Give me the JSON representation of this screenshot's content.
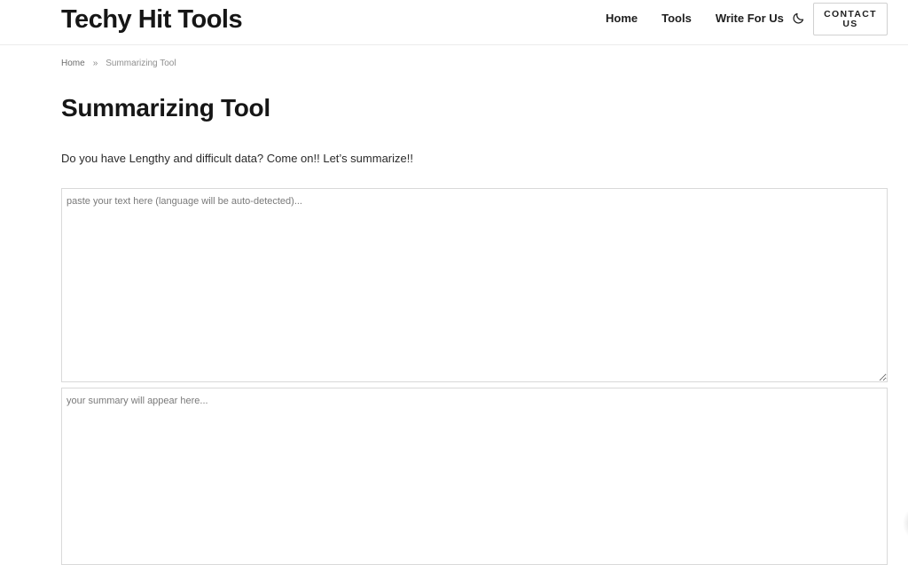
{
  "header": {
    "logo": "Techy Hit Tools",
    "nav": [
      {
        "label": "Home"
      },
      {
        "label": "Tools"
      },
      {
        "label": "Write For Us"
      }
    ],
    "theme_toggle_icon": "moon-icon",
    "contact_label": "CONTACT US"
  },
  "breadcrumb": {
    "home": "Home",
    "separator": "»",
    "current": "Summarizing Tool"
  },
  "main": {
    "title": "Summarizing Tool",
    "intro": "Do you have Lengthy and difficult data? Come on!! Let’s summarize!!",
    "input": {
      "value": "",
      "placeholder": "paste your text here (language will be auto-detected)..."
    },
    "output": {
      "value": "",
      "placeholder": "your summary will appear here..."
    }
  }
}
